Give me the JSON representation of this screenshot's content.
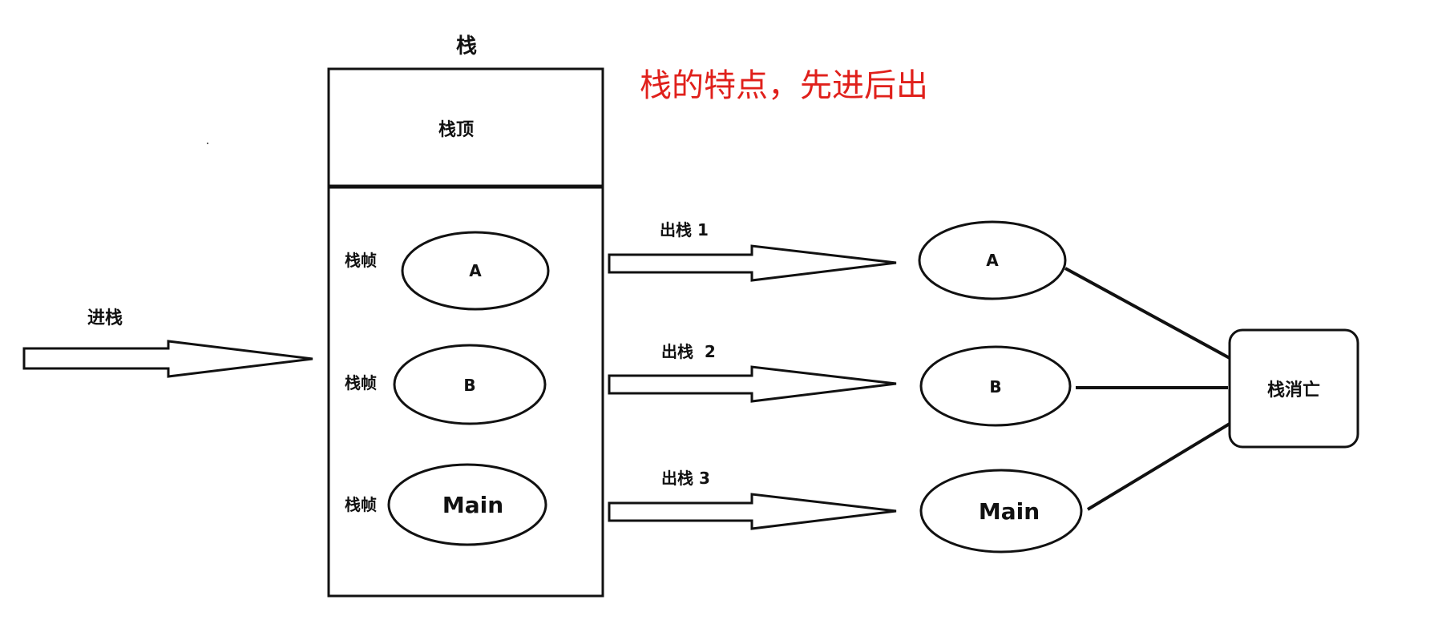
{
  "stack": {
    "title": "栈",
    "top_label": "栈顶",
    "frame_label": "栈帧",
    "frames": [
      {
        "name": "A"
      },
      {
        "name": "B"
      },
      {
        "name": "Main"
      }
    ]
  },
  "note": {
    "text": "栈的特点，先进后出",
    "color": "#e0201b"
  },
  "push": {
    "label": "进栈"
  },
  "pops": [
    {
      "label": "出栈 1"
    },
    {
      "label": "出栈  2"
    },
    {
      "label": "出栈 3"
    }
  ],
  "popped": [
    "A",
    "B",
    "Main"
  ],
  "destroyed": {
    "label": "栈消亡"
  }
}
